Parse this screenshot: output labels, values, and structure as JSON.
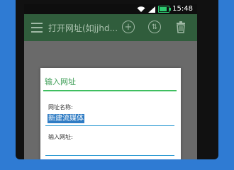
{
  "status_bar": {
    "time": "15:48"
  },
  "toolbar": {
    "title": "打开网址(如jjhd..."
  },
  "dialog": {
    "title": "输入网址",
    "name_label": "网址名称:",
    "name_value": "新建流媒体",
    "url_label": "输入网址:",
    "url_value": ""
  },
  "colors": {
    "toolbar": "#305d3c",
    "accent_green": "#3fbf60",
    "input_underline": "#2d9bd3",
    "selection": "#2f7cc4"
  },
  "icons": [
    "wifi-icon",
    "signal-icon",
    "battery-icon",
    "menu-icon",
    "add-icon",
    "sort-icon",
    "trash-icon"
  ]
}
